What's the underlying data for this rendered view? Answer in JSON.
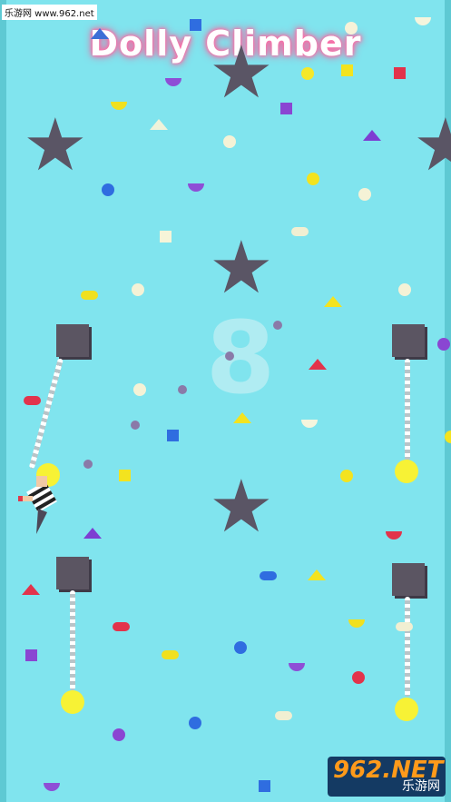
{
  "game": {
    "title": "Dolly Climber",
    "score": "8",
    "watermark_top": "乐游网 www.962.net",
    "logo_main": "962.NET",
    "logo_sub": "乐游网"
  },
  "colors": {
    "background": "#80e4ee",
    "block": "#5b5562",
    "anchor_ball": "#f7f235",
    "star": "#5a5565"
  }
}
